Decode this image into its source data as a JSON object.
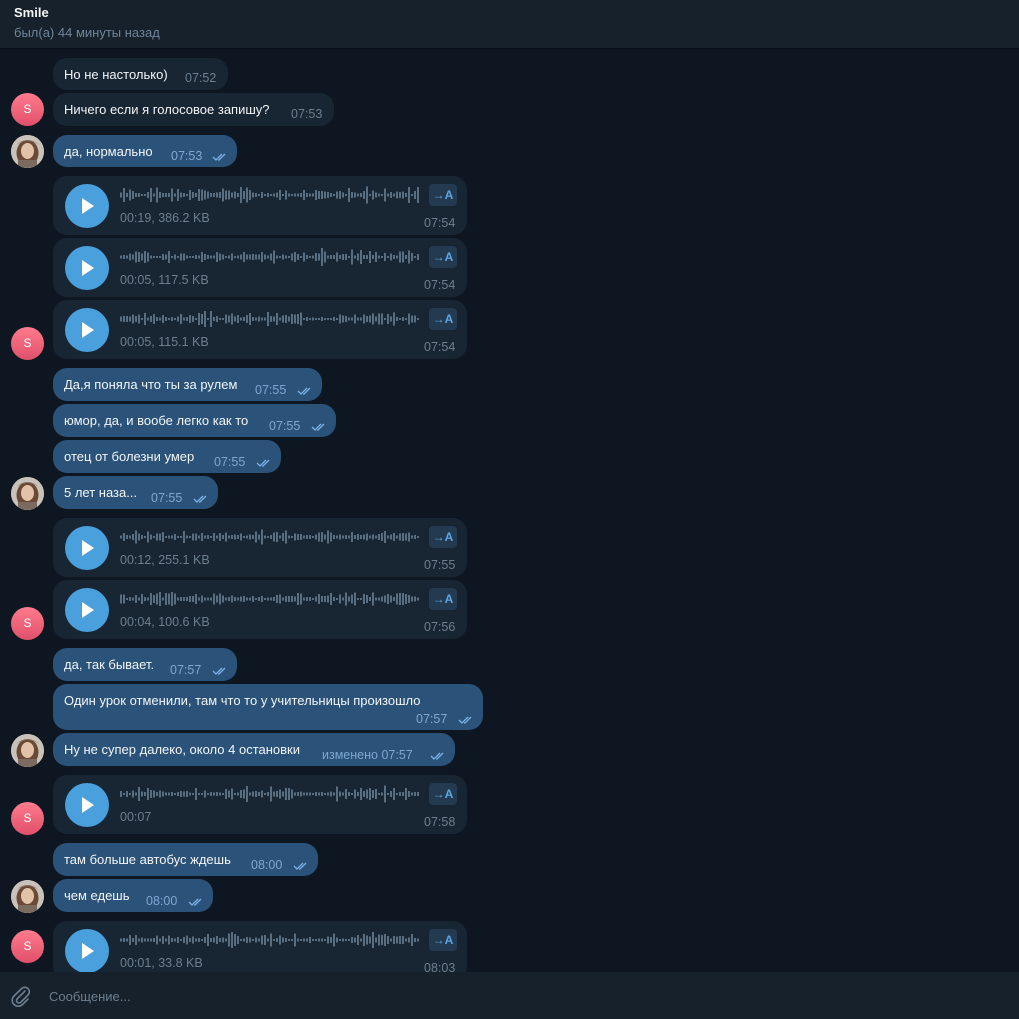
{
  "header": {
    "name": "Smile",
    "status": "был(а) 44 минуты назад"
  },
  "messages": [
    {
      "text": "Но не настолько)",
      "time": "07:52"
    },
    {
      "text": "Ничего если я голосовое запишу?",
      "time": "07:53"
    },
    {
      "text": "да, нормально",
      "time": "07:53"
    },
    {
      "meta": "00:19, 386.2 KB",
      "time": "07:54",
      "tr": "→A"
    },
    {
      "meta": "00:05, 117.5 KB",
      "time": "07:54",
      "tr": "→A"
    },
    {
      "meta": "00:05, 115.1 KB",
      "time": "07:54",
      "tr": "→A"
    },
    {
      "text": "Да,я поняла что ты за рулем",
      "time": "07:55"
    },
    {
      "text": "юмор, да, и вообе легко как то",
      "time": "07:55"
    },
    {
      "text": "отец от болезни умер",
      "time": "07:55"
    },
    {
      "text": "5 лет наза...",
      "time": "07:55"
    },
    {
      "meta": "00:12, 255.1 KB",
      "time": "07:55",
      "tr": "→A"
    },
    {
      "meta": "00:04, 100.6 KB",
      "time": "07:56",
      "tr": "→A"
    },
    {
      "text": "да, так бывает.",
      "time": "07:57"
    },
    {
      "text": "Один урок отменили, там что то у учительницы произошло",
      "time": "07:57"
    },
    {
      "text": "Ну не супер далеко, около 4 остановки",
      "time": "изменено 07:57"
    },
    {
      "meta": "00:07",
      "time": "07:58",
      "tr": "→A"
    },
    {
      "text": "там больше автобус ждешь",
      "time": "08:00"
    },
    {
      "text": "чем едешь",
      "time": "08:00"
    },
    {
      "meta": "00:01, 33.8 KB",
      "time": "08:03",
      "tr": "→A"
    }
  ],
  "avatar_letter": "S",
  "composer": {
    "placeholder": "Сообщение..."
  },
  "icons": [
    "attach-icon",
    "play-icon",
    "double-check-icon",
    "translate-icon"
  ],
  "colors": {
    "background": "#0e1621",
    "incoming": "#182533",
    "outgoing": "#2b5278",
    "accent": "#4a9fdd",
    "avatar": "#e85a72"
  }
}
